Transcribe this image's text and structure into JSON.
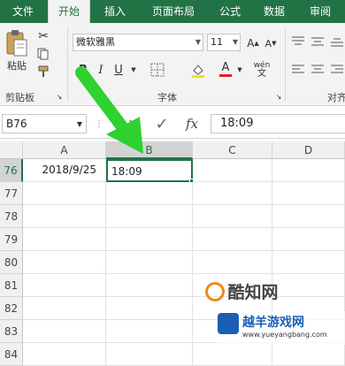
{
  "tabs": [
    {
      "label": "文件",
      "active": false
    },
    {
      "label": "开始",
      "active": true
    },
    {
      "label": "插入",
      "active": false
    },
    {
      "label": "页面布局",
      "active": false
    },
    {
      "label": "公式",
      "active": false
    },
    {
      "label": "数据",
      "active": false
    },
    {
      "label": "审阅",
      "active": false
    }
  ],
  "ribbon": {
    "clipboard": {
      "paste_label": "粘贴",
      "group_label": "剪贴板"
    },
    "font": {
      "name": "微软雅黑",
      "size": "11",
      "group_label": "字体",
      "bold": "B",
      "italic": "I",
      "underline": "U",
      "grow": "A",
      "shrink": "A",
      "font_color_glyph": "A",
      "phonetic": "wén"
    },
    "alignment": {
      "group_label": "对齐"
    }
  },
  "formula_bar": {
    "name_box": "B76",
    "cancel": "✕",
    "enter": "✓",
    "fx": "fx",
    "value": "18:09"
  },
  "grid": {
    "columns": [
      "A",
      "B",
      "C",
      "D"
    ],
    "rows": [
      {
        "num": "76",
        "a": "2018/9/25",
        "b": "18:09"
      },
      {
        "num": "77",
        "a": "",
        "b": ""
      },
      {
        "num": "78",
        "a": "",
        "b": ""
      },
      {
        "num": "79",
        "a": "",
        "b": ""
      },
      {
        "num": "80",
        "a": "",
        "b": ""
      },
      {
        "num": "81",
        "a": "",
        "b": ""
      },
      {
        "num": "82",
        "a": "",
        "b": ""
      },
      {
        "num": "83",
        "a": "",
        "b": ""
      },
      {
        "num": "84",
        "a": "",
        "b": ""
      }
    ],
    "selected_cell": "B76"
  },
  "watermark": {
    "title": "酷知网",
    "line2": "越羊游戏网",
    "url": "www.yueyangbang.com"
  },
  "colors": {
    "accent": "#217346",
    "arrow": "#2fd12f",
    "font_red": "#e02020"
  }
}
